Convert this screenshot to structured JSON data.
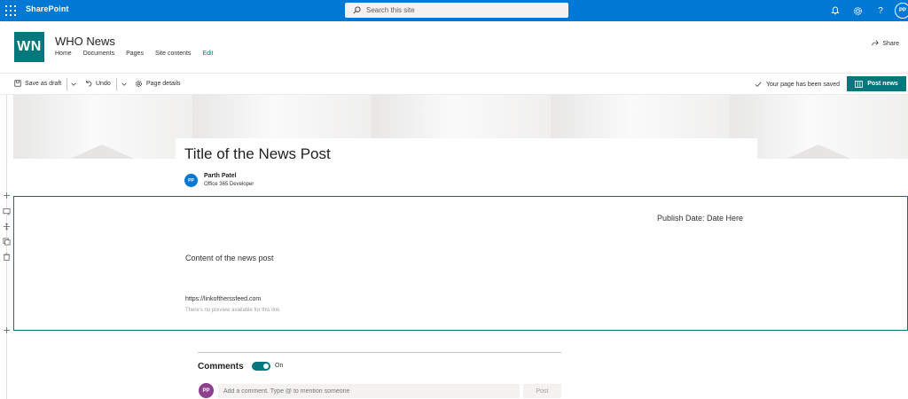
{
  "suitebar": {
    "brand": "SharePoint",
    "search_placeholder": "Search this site",
    "user_initials": "PP",
    "background": "#0078d4"
  },
  "site": {
    "logo_text": "WN",
    "title": "WHO News",
    "nav": [
      "Home",
      "Documents",
      "Pages",
      "Site contents",
      "Edit"
    ],
    "share_label": "Share",
    "accent": "#03787c"
  },
  "commandbar": {
    "save_draft": "Save as draft",
    "undo": "Undo",
    "page_details": "Page details",
    "saved_status": "Your page has been saved",
    "post_news": "Post news"
  },
  "article": {
    "title": "Title of the News Post",
    "author_initials": "PP",
    "author_name": "Parth Patel",
    "author_role": "Office 365 Developer",
    "publish_date": "Publish Date: Date Here",
    "content": "Content of the news post",
    "link_url": "https://linkoftherssfeed.com",
    "link_preview": "There's no preview available for this link."
  },
  "comments": {
    "label": "Comments",
    "toggle_state": "On",
    "user_initials": "PP",
    "input_placeholder": "Add a comment. Type @ to mention someone",
    "post_label": "Post"
  },
  "icons": {
    "waffle": "app-launcher-icon",
    "search": "search-icon",
    "bell": "notification-icon",
    "settings": "gear-icon",
    "help": "help-icon",
    "share": "share-icon",
    "save": "save-icon",
    "undo": "undo-icon",
    "page_details": "page-details-icon",
    "check": "checkmark-icon",
    "post": "post-icon"
  }
}
